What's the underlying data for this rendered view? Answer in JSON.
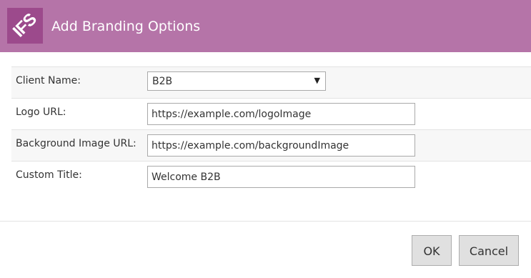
{
  "dialog": {
    "title": "Add Branding Options",
    "logo_text": "IFS",
    "accent_color": "#b574a8",
    "logo_color": "#9c4a8c"
  },
  "form": {
    "client_name": {
      "label": "Client Name:",
      "value": "B2B",
      "icon": "dropdown-arrow-icon"
    },
    "logo_url": {
      "label": "Logo URL:",
      "value": "https://example.com/logoImage"
    },
    "background_image_url": {
      "label": "Background Image URL:",
      "value": "https://example.com/backgroundImage"
    },
    "custom_title": {
      "label": "Custom Title:",
      "value": "Welcome B2B"
    }
  },
  "buttons": {
    "ok": "OK",
    "cancel": "Cancel"
  }
}
